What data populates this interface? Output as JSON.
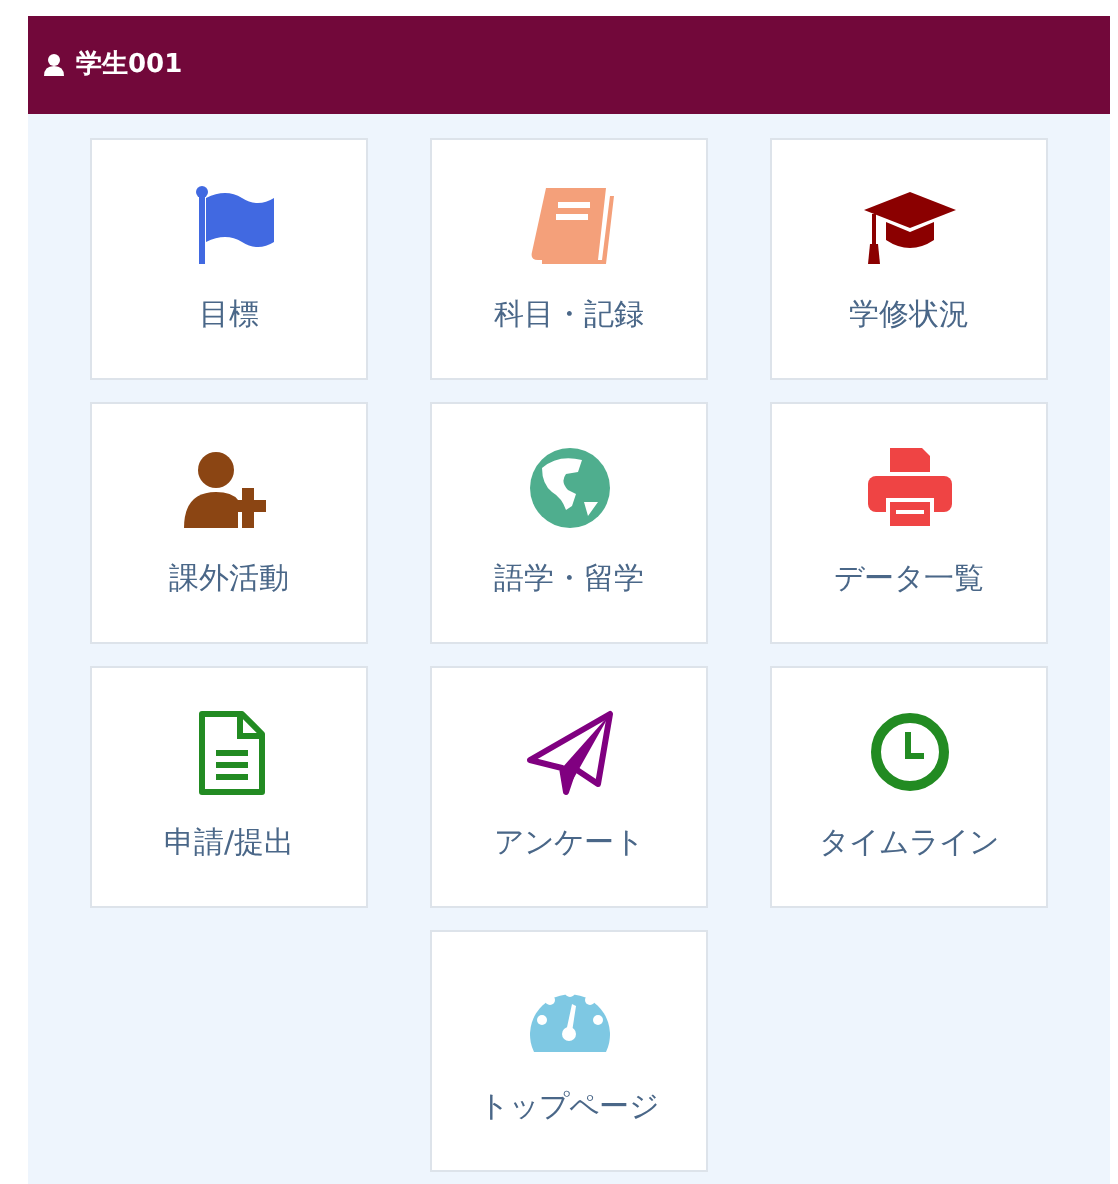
{
  "header": {
    "user": "学生001"
  },
  "tiles": [
    {
      "label": "目標",
      "kind": "flag",
      "color": "#4169e1"
    },
    {
      "label": "科目・記録",
      "kind": "book",
      "color": "#f4a07a"
    },
    {
      "label": "学修状況",
      "kind": "cap",
      "color": "#8b0000"
    },
    {
      "label": "課外活動",
      "kind": "userplus",
      "color": "#8b4513"
    },
    {
      "label": "語学・留学",
      "kind": "globe",
      "color": "#4fae8e"
    },
    {
      "label": "データ一覧",
      "kind": "printer",
      "color": "#ef4444"
    },
    {
      "label": "申請/提出",
      "kind": "file",
      "color": "#228b22"
    },
    {
      "label": "アンケート",
      "kind": "plane",
      "color": "#800080"
    },
    {
      "label": "タイムライン",
      "kind": "clock",
      "color": "#228b22"
    },
    {
      "label": "トップページ",
      "kind": "gauge",
      "color": "#7ec8e3"
    }
  ]
}
